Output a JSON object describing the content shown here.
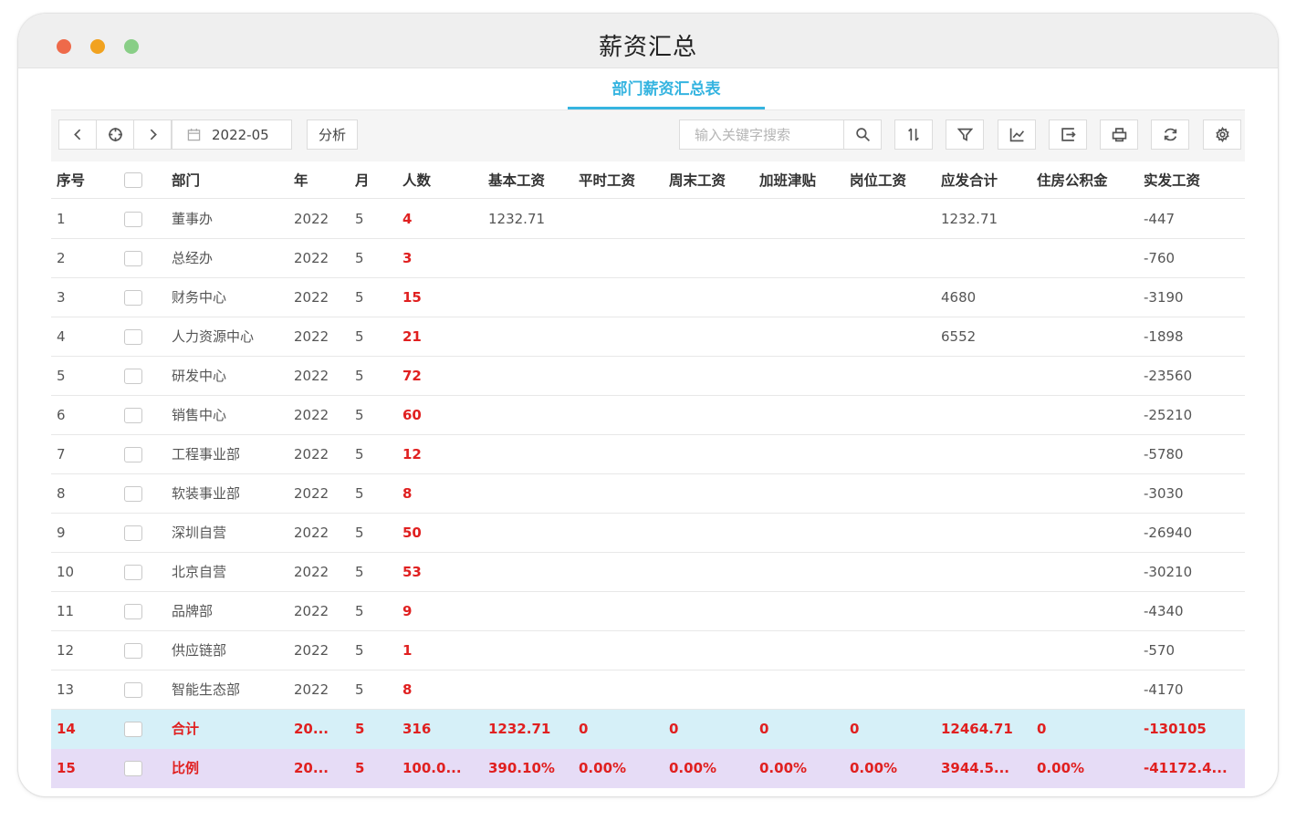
{
  "window": {
    "title": "薪资汇总"
  },
  "tabs": [
    {
      "label": "部门薪资汇总表",
      "active": true
    }
  ],
  "toolbar": {
    "date": "2022-05",
    "analyze_label": "分析",
    "search_placeholder": "输入关键字搜索"
  },
  "icons": {
    "prev": "chevron-left-icon",
    "today": "crosshair-icon",
    "next": "chevron-right-icon",
    "calendar": "calendar-icon",
    "search": "search-icon",
    "sort": "sort-icon",
    "filter": "filter-icon",
    "chart": "line-chart-icon",
    "export": "export-icon",
    "print": "print-icon",
    "refresh": "refresh-icon",
    "settings": "gear-icon"
  },
  "colors": {
    "accent": "#35b4e0",
    "highlight_red": "#e02020",
    "total_row_bg": "#d6f0f8",
    "ratio_row_bg": "#e6dcf6"
  },
  "table": {
    "headers": {
      "seq": "序号",
      "dept": "部门",
      "year": "年",
      "month": "月",
      "count": "人数",
      "base": "基本工资",
      "regular": "平时工资",
      "weekend": "周末工资",
      "overtime": "加班津贴",
      "position": "岗位工资",
      "gross": "应发合计",
      "housing": "住房公积金",
      "net": "实发工资"
    },
    "rows": [
      {
        "seq": "1",
        "dept": "董事办",
        "year": "2022",
        "month": "5",
        "count": "4",
        "base": "1232.71",
        "regular": "",
        "weekend": "",
        "overtime": "",
        "position": "",
        "gross": "1232.71",
        "housing": "",
        "net": "-447"
      },
      {
        "seq": "2",
        "dept": "总经办",
        "year": "2022",
        "month": "5",
        "count": "3",
        "base": "",
        "regular": "",
        "weekend": "",
        "overtime": "",
        "position": "",
        "gross": "",
        "housing": "",
        "net": "-760"
      },
      {
        "seq": "3",
        "dept": "财务中心",
        "year": "2022",
        "month": "5",
        "count": "15",
        "base": "",
        "regular": "",
        "weekend": "",
        "overtime": "",
        "position": "",
        "gross": "4680",
        "housing": "",
        "net": "-3190"
      },
      {
        "seq": "4",
        "dept": "人力资源中心",
        "year": "2022",
        "month": "5",
        "count": "21",
        "base": "",
        "regular": "",
        "weekend": "",
        "overtime": "",
        "position": "",
        "gross": "6552",
        "housing": "",
        "net": "-1898"
      },
      {
        "seq": "5",
        "dept": "研发中心",
        "year": "2022",
        "month": "5",
        "count": "72",
        "base": "",
        "regular": "",
        "weekend": "",
        "overtime": "",
        "position": "",
        "gross": "",
        "housing": "",
        "net": "-23560"
      },
      {
        "seq": "6",
        "dept": "销售中心",
        "year": "2022",
        "month": "5",
        "count": "60",
        "base": "",
        "regular": "",
        "weekend": "",
        "overtime": "",
        "position": "",
        "gross": "",
        "housing": "",
        "net": "-25210"
      },
      {
        "seq": "7",
        "dept": "工程事业部",
        "year": "2022",
        "month": "5",
        "count": "12",
        "base": "",
        "regular": "",
        "weekend": "",
        "overtime": "",
        "position": "",
        "gross": "",
        "housing": "",
        "net": "-5780"
      },
      {
        "seq": "8",
        "dept": "软装事业部",
        "year": "2022",
        "month": "5",
        "count": "8",
        "base": "",
        "regular": "",
        "weekend": "",
        "overtime": "",
        "position": "",
        "gross": "",
        "housing": "",
        "net": "-3030"
      },
      {
        "seq": "9",
        "dept": "深圳自营",
        "year": "2022",
        "month": "5",
        "count": "50",
        "base": "",
        "regular": "",
        "weekend": "",
        "overtime": "",
        "position": "",
        "gross": "",
        "housing": "",
        "net": "-26940"
      },
      {
        "seq": "10",
        "dept": "北京自营",
        "year": "2022",
        "month": "5",
        "count": "53",
        "base": "",
        "regular": "",
        "weekend": "",
        "overtime": "",
        "position": "",
        "gross": "",
        "housing": "",
        "net": "-30210"
      },
      {
        "seq": "11",
        "dept": "品牌部",
        "year": "2022",
        "month": "5",
        "count": "9",
        "base": "",
        "regular": "",
        "weekend": "",
        "overtime": "",
        "position": "",
        "gross": "",
        "housing": "",
        "net": "-4340"
      },
      {
        "seq": "12",
        "dept": "供应链部",
        "year": "2022",
        "month": "5",
        "count": "1",
        "base": "",
        "regular": "",
        "weekend": "",
        "overtime": "",
        "position": "",
        "gross": "",
        "housing": "",
        "net": "-570"
      },
      {
        "seq": "13",
        "dept": "智能生态部",
        "year": "2022",
        "month": "5",
        "count": "8",
        "base": "",
        "regular": "",
        "weekend": "",
        "overtime": "",
        "position": "",
        "gross": "",
        "housing": "",
        "net": "-4170"
      }
    ],
    "total": {
      "seq": "14",
      "dept": "合计",
      "year": "20...",
      "month": "5",
      "count": "316",
      "base": "1232.71",
      "regular": "0",
      "weekend": "0",
      "overtime": "0",
      "position": "0",
      "gross": "12464.71",
      "housing": "0",
      "net": "-130105"
    },
    "ratio": {
      "seq": "15",
      "dept": "比例",
      "year": "20...",
      "month": "5",
      "count": "100.0...",
      "base": "390.10%",
      "regular": "0.00%",
      "weekend": "0.00%",
      "overtime": "0.00%",
      "position": "0.00%",
      "gross": "3944.5...",
      "housing": "0.00%",
      "net": "-41172.4..."
    }
  }
}
